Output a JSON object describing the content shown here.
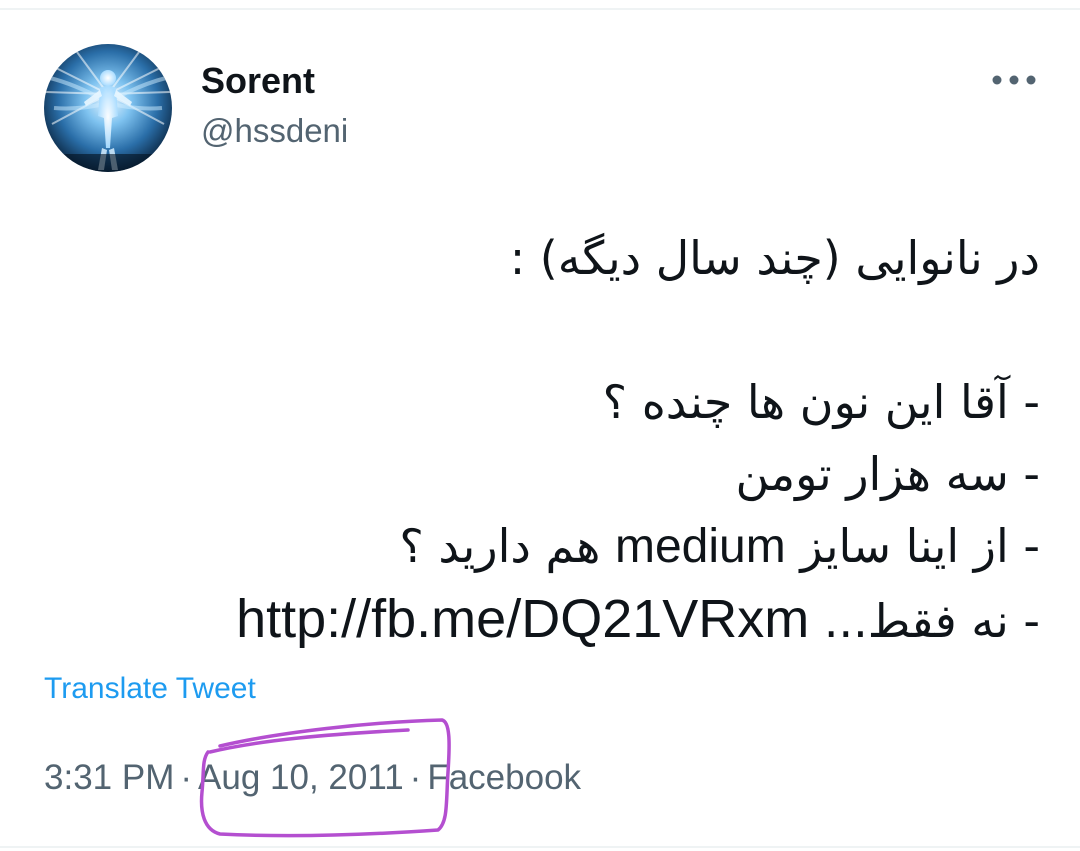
{
  "user": {
    "display_name": "Sorent",
    "handle": "@hssdeni"
  },
  "tweet": {
    "lines": [
      "در نانوایی (چند سال دیگه) :",
      "",
      "- آقا این نون ها چنده ؟",
      "- سه هزار تومن",
      "- از اینا سایز",
      "medium",
      "هم دارید ؟",
      "- نه فقط...",
      "http://fb.me/DQ21VRxm"
    ],
    "translate_label": "Translate Tweet"
  },
  "meta": {
    "time": "3:31 PM",
    "separator": "·",
    "date": "Aug 10, 2011",
    "source": "Facebook"
  },
  "icons": {
    "more": "more-horizontal-icon",
    "avatar": "glowing-figure-avatar"
  },
  "colors": {
    "text_primary": "#0f1419",
    "text_secondary": "#536471",
    "link": "#1d9bf0",
    "annotation": "#b44fd0"
  }
}
